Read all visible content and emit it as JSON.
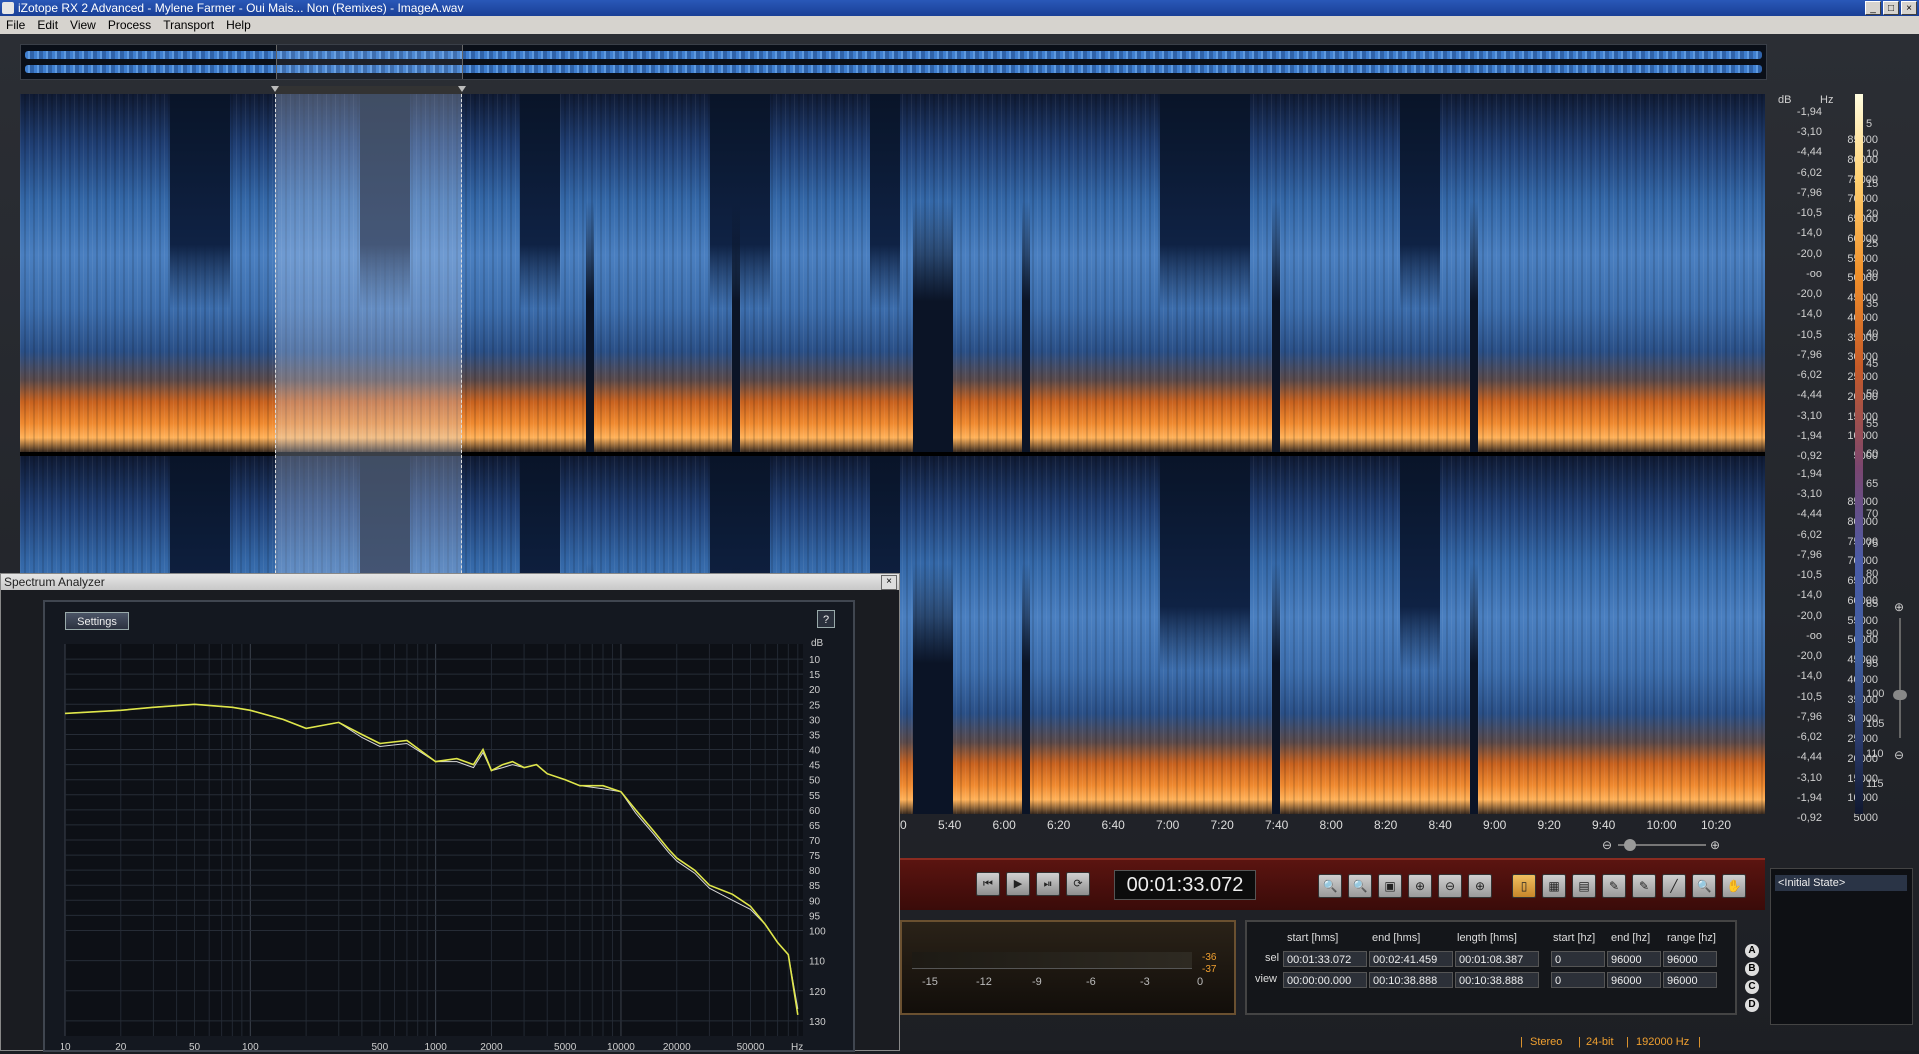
{
  "window": {
    "title": "iZotope RX 2 Advanced - Mylene Farmer - Oui Mais... Non (Remixes) - ImageA.wav",
    "buttons": [
      "_",
      "□",
      "×"
    ]
  },
  "menu": [
    "File",
    "Edit",
    "View",
    "Process",
    "Transport",
    "Help"
  ],
  "scales": {
    "db_header": "dB",
    "hz_header": "Hz",
    "db_ticks_top": [
      "-1,94",
      "-3,10",
      "-4,44",
      "-6,02",
      "-7,96",
      "-10,5",
      "-14,0",
      "-20,0",
      "-oo",
      "-20,0",
      "-14,0",
      "-10,5",
      "-7,96",
      "-6,02",
      "-4,44",
      "-3,10",
      "-1,94",
      "-0,92"
    ],
    "db_ticks_bottom": [
      "-1,94",
      "-3,10",
      "-4,44",
      "-6,02",
      "-7,96",
      "-10,5",
      "-14,0",
      "-20,0",
      "-oo",
      "-20,0",
      "-14,0",
      "-10,5",
      "-7,96",
      "-6,02",
      "-4,44",
      "-3,10",
      "-1,94",
      "-0,92"
    ],
    "hz_ticks_top": [
      "85000",
      "80000",
      "75000",
      "70000",
      "65000",
      "60000",
      "55000",
      "50000",
      "45000",
      "40000",
      "35000",
      "30000",
      "25000",
      "20000",
      "15000",
      "10000",
      "5000"
    ],
    "hz_ticks_bottom": [
      "85000",
      "80000",
      "75000",
      "70000",
      "65000",
      "60000",
      "55000",
      "50000",
      "45000",
      "40000",
      "35000",
      "30000",
      "25000",
      "20000",
      "15000",
      "10000",
      "5000"
    ],
    "color_ticks": [
      "5",
      "10",
      "15",
      "20",
      "25",
      "30",
      "35",
      "40",
      "45",
      "50",
      "55",
      "60",
      "65",
      "70",
      "75",
      "80",
      "85",
      "90",
      "95",
      "100",
      "105",
      "110",
      "115"
    ]
  },
  "timeline": [
    "0",
    "5:40",
    "6:00",
    "6:20",
    "6:40",
    "7:00",
    "7:20",
    "7:40",
    "8:00",
    "8:20",
    "8:40",
    "9:00",
    "9:20",
    "9:40",
    "10:00",
    "10:20"
  ],
  "transport": {
    "timecode": "00:01:33.072",
    "buttons": [
      "⏮",
      "▶",
      "⏯",
      "⟳"
    ],
    "tools": [
      "🔍",
      "🔍",
      "▣",
      "⊕",
      "⊖",
      "⊕",
      "▯",
      "▦",
      "▤",
      "✎",
      "✎",
      "╱",
      "🔍",
      "✋"
    ]
  },
  "meter": {
    "ticks": [
      "-15",
      "-12",
      "-9",
      "-6",
      "-3",
      "0"
    ],
    "peak_top": "-36",
    "peak_bottom": "-37"
  },
  "selection_info": {
    "headers": [
      "start [hms]",
      "end [hms]",
      "length [hms]",
      "start [hz]",
      "end [hz]",
      "range [hz]"
    ],
    "sel_label": "sel",
    "view_label": "view",
    "sel": [
      "00:01:33.072",
      "00:02:41.459",
      "00:01:08.387",
      "0",
      "96000",
      "96000"
    ],
    "view": [
      "00:00:00.000",
      "00:10:38.888",
      "00:10:38.888",
      "0",
      "96000",
      "96000"
    ]
  },
  "abcd": [
    "A",
    "B",
    "C",
    "D"
  ],
  "history": {
    "item": "<Initial State>"
  },
  "status": {
    "channels": "Stereo",
    "bits": "24-bit",
    "rate": "192000 Hz"
  },
  "spectrum_analyzer": {
    "title": "Spectrum Analyzer",
    "close": "×",
    "settings": "Settings",
    "help": "?",
    "db_unit": "dB",
    "hz_unit": "Hz",
    "db_ticks": [
      "10",
      "15",
      "20",
      "25",
      "30",
      "35",
      "40",
      "45",
      "50",
      "55",
      "60",
      "65",
      "70",
      "75",
      "80",
      "85",
      "90",
      "95",
      "100",
      "110",
      "120",
      "130"
    ],
    "hz_ticks": [
      "10",
      "20",
      "50",
      "100",
      "500",
      "1000",
      "2000",
      "5000",
      "10000",
      "20000",
      "50000"
    ]
  },
  "chart_data": {
    "type": "line",
    "xlabel": "Hz",
    "ylabel": "dB",
    "x_scale": "log",
    "xlim": [
      10,
      96000
    ],
    "ylim": [
      -135,
      -5
    ],
    "grid": true,
    "series": [
      {
        "x": [
          10,
          20,
          30,
          50,
          80,
          100,
          150,
          200,
          300,
          400,
          500,
          700,
          1000,
          1300,
          1600,
          1800,
          2000,
          2300,
          2600,
          3000,
          3500,
          4000,
          5000,
          6000,
          8000,
          10000,
          12000,
          15000,
          18000,
          20000,
          25000,
          30000,
          40000,
          50000,
          60000,
          70000,
          80000,
          90000
        ],
        "y": [
          -28,
          -27,
          -26,
          -25,
          -26,
          -27,
          -30,
          -33,
          -31,
          -35,
          -38,
          -37,
          -44,
          -43,
          -45,
          -40,
          -47,
          -45,
          -44,
          -46,
          -45,
          -48,
          -50,
          -52,
          -52,
          -54,
          -60,
          -67,
          -73,
          -76,
          -80,
          -85,
          -88,
          -92,
          -98,
          -104,
          -108,
          -128
        ]
      },
      {
        "x": [
          10,
          20,
          30,
          50,
          80,
          100,
          150,
          200,
          300,
          400,
          500,
          700,
          1000,
          1300,
          1600,
          1800,
          2000,
          2300,
          2600,
          3000,
          3500,
          4000,
          5000,
          6000,
          8000,
          10000,
          12000,
          15000,
          18000,
          20000,
          25000,
          30000,
          40000,
          50000,
          60000,
          70000,
          80000,
          90000
        ],
        "y": [
          -28,
          -27,
          -26,
          -25,
          -26,
          -27,
          -30,
          -33,
          -31,
          -36,
          -39,
          -38,
          -44,
          -44,
          -46,
          -41,
          -47,
          -46,
          -45,
          -46,
          -45,
          -48,
          -50,
          -52,
          -53,
          -54,
          -61,
          -68,
          -74,
          -77,
          -81,
          -86,
          -90,
          -93,
          -98,
          -104,
          -108,
          -126
        ]
      }
    ]
  }
}
